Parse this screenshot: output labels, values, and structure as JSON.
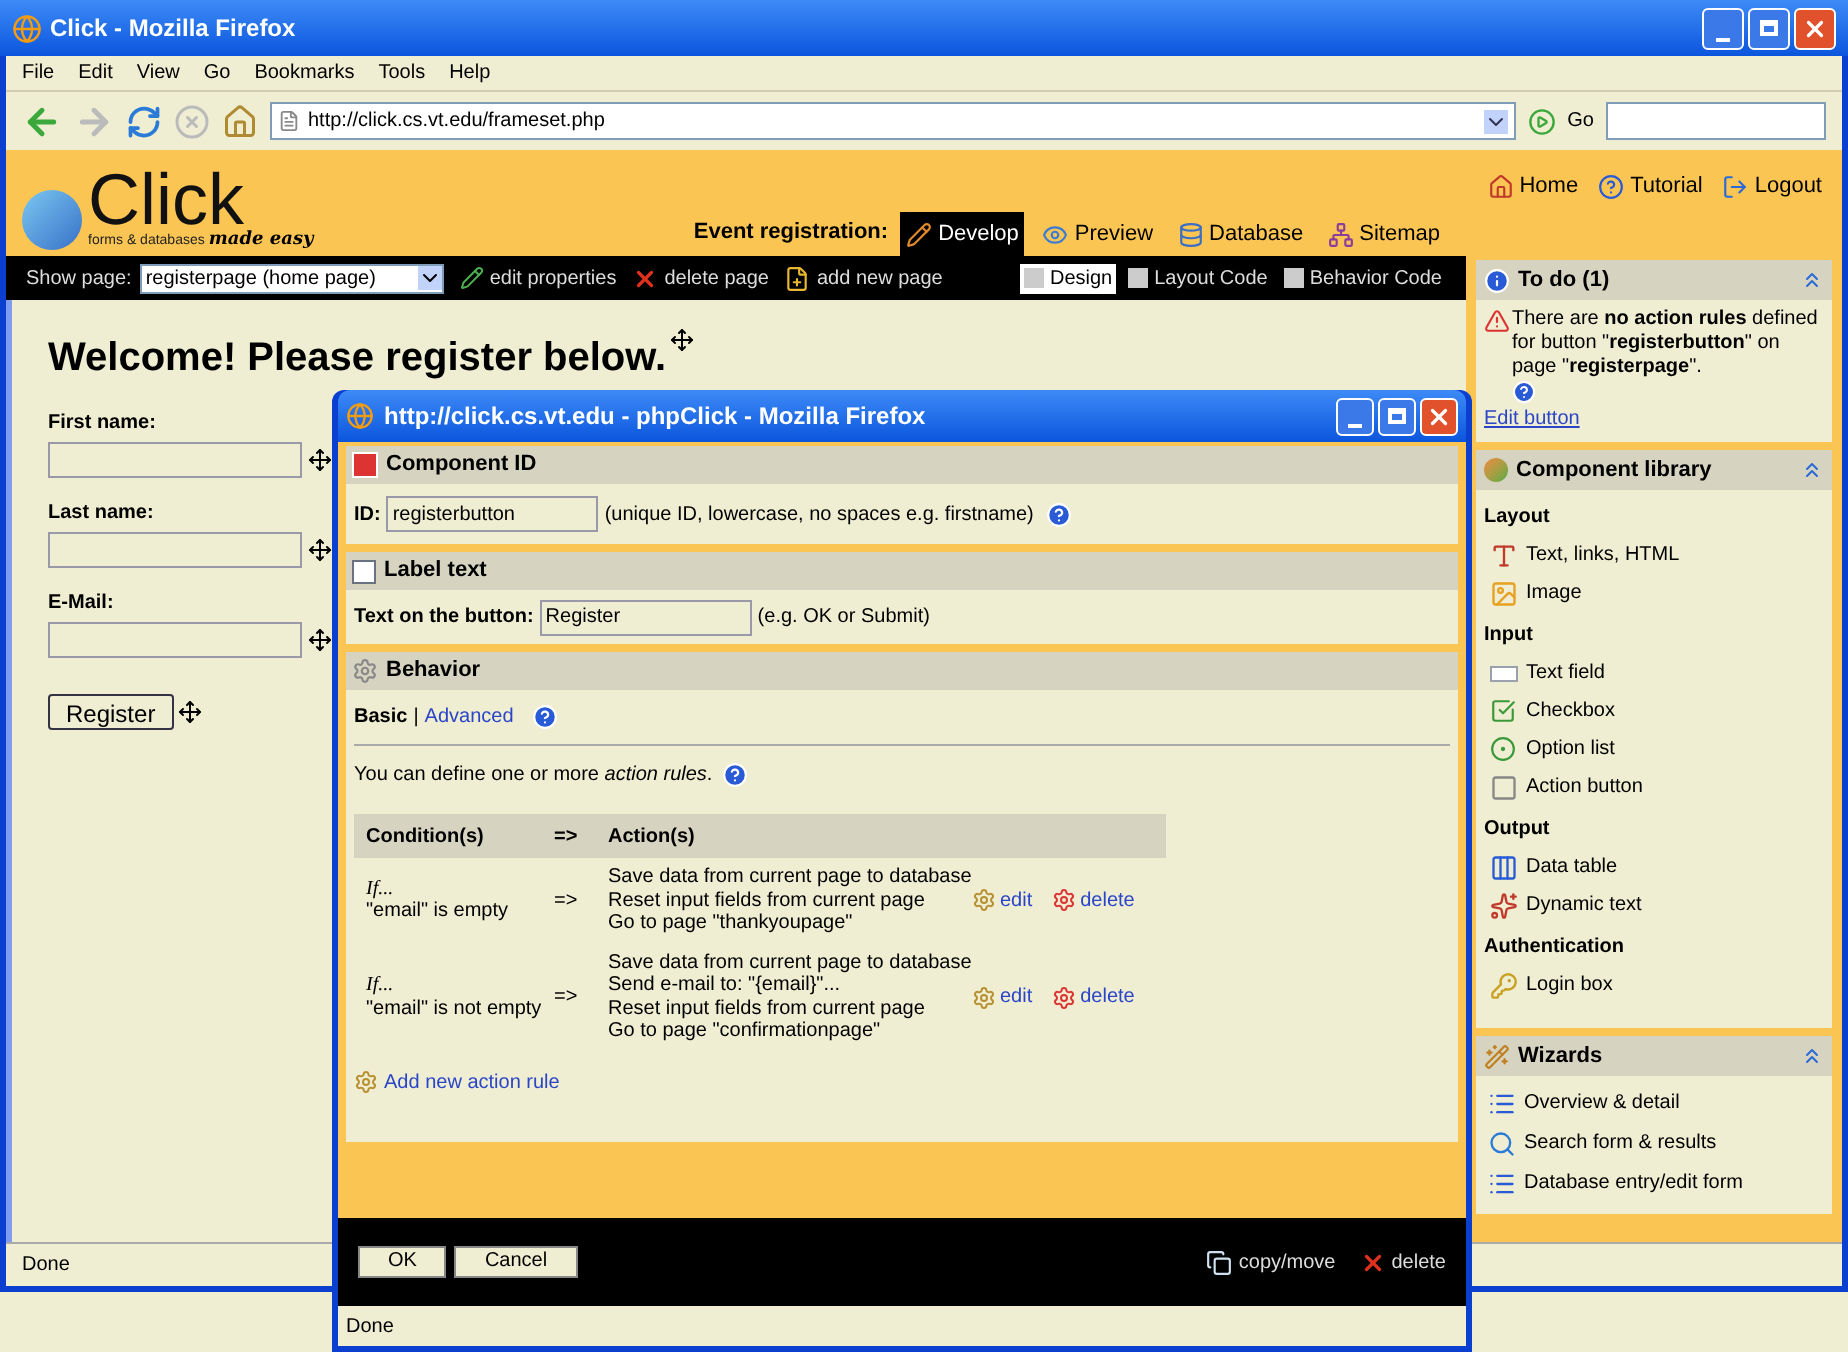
{
  "window": {
    "title": "Click - Mozilla Firefox"
  },
  "menu": [
    "File",
    "Edit",
    "View",
    "Go",
    "Bookmarks",
    "Tools",
    "Help"
  ],
  "address_bar": {
    "value": "http://click.cs.vt.edu/frameset.php",
    "go": "Go"
  },
  "app_header": {
    "logo": "Click",
    "tagline": "forms & databases",
    "tagline_script": "made easy",
    "project": "Event registration:",
    "tabs": [
      {
        "label": "Develop",
        "kind": "develop",
        "selected": true
      },
      {
        "label": "Preview",
        "kind": "preview",
        "selected": false
      },
      {
        "label": "Database",
        "kind": "database",
        "selected": false
      },
      {
        "label": "Sitemap",
        "kind": "sitemap",
        "selected": false
      }
    ],
    "links": [
      {
        "label": "Home",
        "kind": "home"
      },
      {
        "label": "Tutorial",
        "kind": "help"
      },
      {
        "label": "Logout",
        "kind": "logout"
      }
    ]
  },
  "page_toolbar": {
    "label": "Show page:",
    "page": "registerpage (home page)",
    "actions": [
      {
        "label": "edit properties",
        "kind": "edit"
      },
      {
        "label": "delete page",
        "kind": "delete"
      },
      {
        "label": "add new page",
        "kind": "add"
      }
    ],
    "views": [
      {
        "label": "Design",
        "selected": true
      },
      {
        "label": "Layout Code",
        "selected": false
      },
      {
        "label": "Behavior Code",
        "selected": false
      }
    ]
  },
  "canvas": {
    "heading": "Welcome! Please register below.",
    "fields": [
      {
        "label": "First name:"
      },
      {
        "label": "Last name:"
      },
      {
        "label": "E-Mail:"
      }
    ],
    "button": "Register"
  },
  "sidebar": {
    "todo": {
      "title": "To do (1)",
      "message": "There are **no action rules** defined for button \"**registerbutton**\" on page \"**registerpage**\".",
      "link": "Edit button"
    },
    "library": {
      "title": "Component library",
      "groups": [
        {
          "title": "Layout",
          "items": [
            {
              "label": "Text, links, HTML",
              "kind": "text"
            },
            {
              "label": "Image",
              "kind": "image"
            }
          ]
        },
        {
          "title": "Input",
          "items": [
            {
              "label": "Text field",
              "kind": "textfield"
            },
            {
              "label": "Checkbox",
              "kind": "checkbox"
            },
            {
              "label": "Option list",
              "kind": "option"
            },
            {
              "label": "Action button",
              "kind": "button"
            }
          ]
        },
        {
          "title": "Output",
          "items": [
            {
              "label": "Data table",
              "kind": "table"
            },
            {
              "label": "Dynamic text",
              "kind": "dynamic"
            }
          ]
        },
        {
          "title": "Authentication",
          "items": [
            {
              "label": "Login box",
              "kind": "login"
            }
          ]
        }
      ]
    },
    "wizards": {
      "title": "Wizards",
      "items": [
        {
          "label": "Overview & detail",
          "kind": "list"
        },
        {
          "label": "Search form & results",
          "kind": "search"
        },
        {
          "label": "Database entry/edit form",
          "kind": "list"
        }
      ]
    }
  },
  "status_bar": "Done",
  "dialog": {
    "title": "http://click.cs.vt.edu - phpClick - Mozilla Firefox",
    "component_id": {
      "title": "Component ID",
      "label": "ID:",
      "value": "registerbutton",
      "hint": "(unique ID, lowercase, no spaces e.g. firstname)"
    },
    "label_text": {
      "title": "Label text",
      "label": "Text on the button:",
      "value": "Register",
      "hint": "(e.g. OK or Submit)"
    },
    "behavior": {
      "title": "Behavior",
      "mode_separator": "|",
      "modes": [
        {
          "label": "Basic",
          "selected": true
        },
        {
          "label": "Advanced",
          "selected": false
        }
      ],
      "intro": "You can define one or more *action rules*.",
      "columns": [
        "Condition(s)",
        "=>",
        "Action(s)"
      ],
      "rules": [
        {
          "prefix": "If...",
          "condition": "\"email\" is empty",
          "arrow": "=>",
          "actions": [
            "Save data from current page to database",
            "Reset input fields from current page",
            "Go to page \"thankyoupage\""
          ],
          "edit": "edit",
          "delete": "delete"
        },
        {
          "prefix": "If...",
          "condition": "\"email\" is not empty",
          "arrow": "=>",
          "actions": [
            "Save data from current page to database",
            "Send e-mail to: \"{email}\"...",
            "Reset input fields from current page",
            "Go to page \"confirmationpage\""
          ],
          "edit": "edit",
          "delete": "delete"
        }
      ],
      "add_rule": "Add new action rule"
    },
    "buttons": [
      "OK",
      "Cancel"
    ],
    "footer_actions": [
      {
        "label": "copy/move",
        "kind": "copy"
      },
      {
        "label": "delete",
        "kind": "delete"
      }
    ],
    "status": "Done"
  }
}
